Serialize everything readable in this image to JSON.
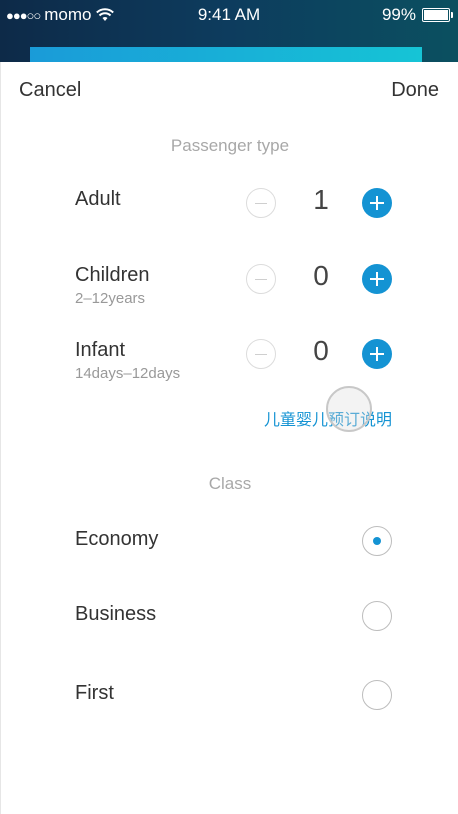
{
  "status": {
    "carrier": "momo",
    "time": "9:41 AM",
    "battery": "99%",
    "battery_level": 0.99
  },
  "progress": {
    "value": 1.0
  },
  "nav": {
    "cancel": "Cancel",
    "done": "Done"
  },
  "passenger": {
    "title": "Passenger type",
    "rows": [
      {
        "label": "Adult",
        "sub": "",
        "count": "1"
      },
      {
        "label": "Children",
        "sub": "2–12years",
        "count": "0"
      },
      {
        "label": "Infant",
        "sub": "14days–12days",
        "count": "0"
      }
    ],
    "help_link": "儿童婴儿预订说明"
  },
  "class": {
    "title": "Class",
    "options": [
      {
        "label": "Economy",
        "selected": true
      },
      {
        "label": "Business",
        "selected": false
      },
      {
        "label": "First",
        "selected": false
      }
    ]
  },
  "colors": {
    "accent": "#1493d3",
    "statusbar": "#0d2a48"
  }
}
